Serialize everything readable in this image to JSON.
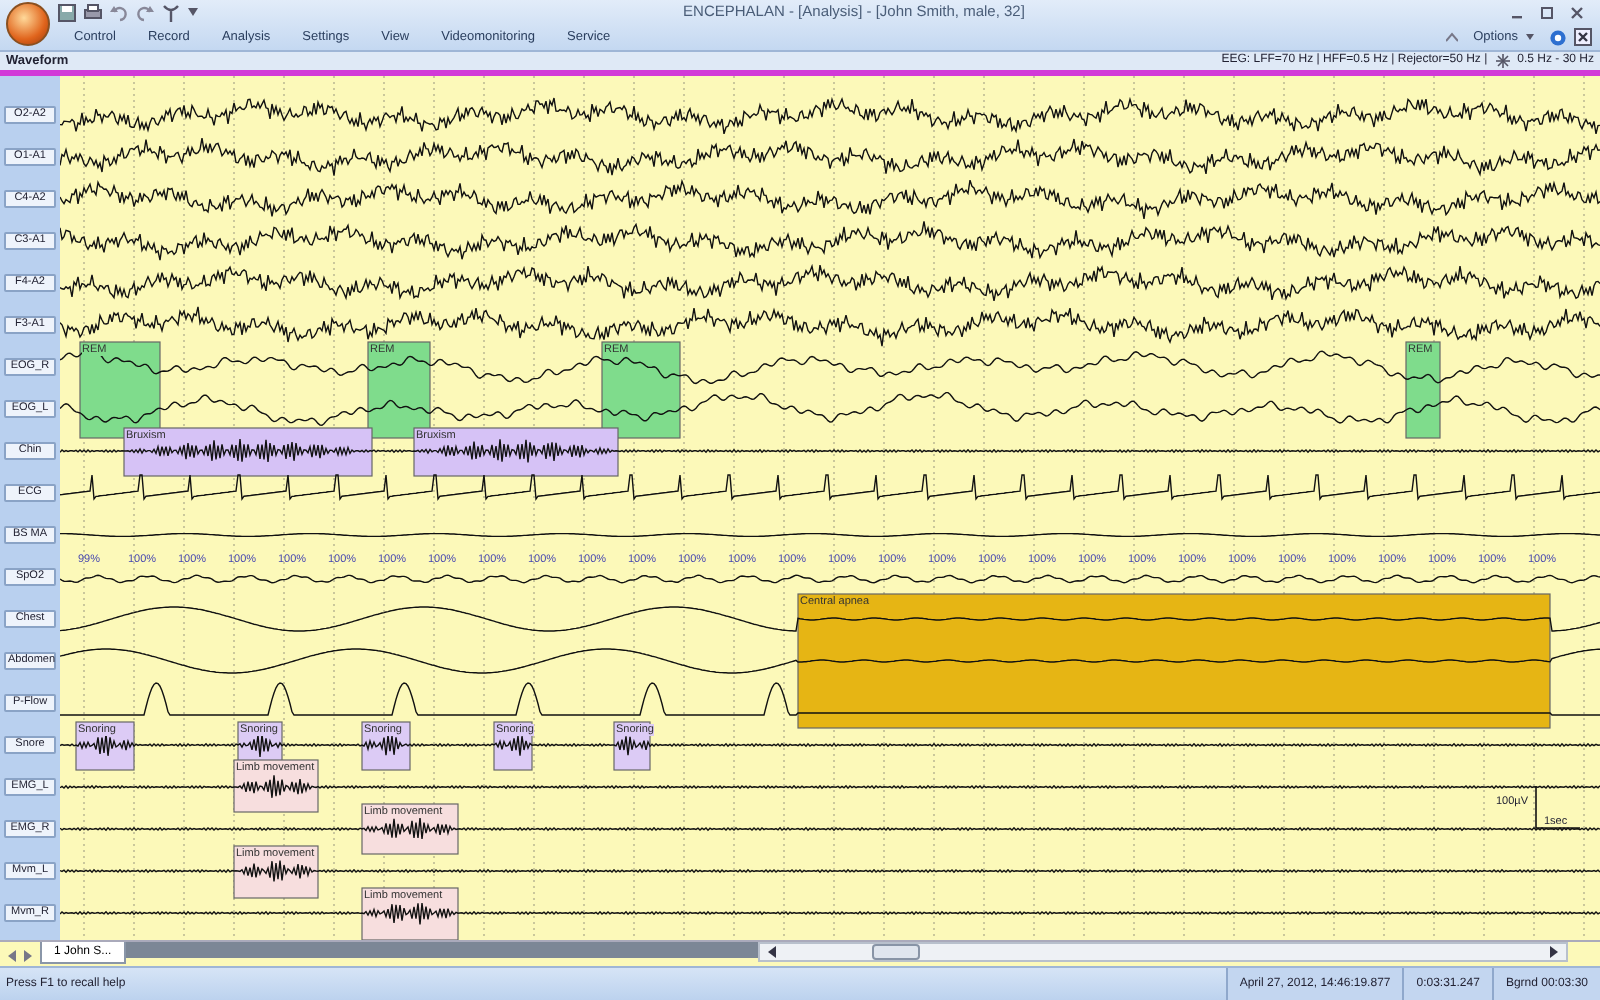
{
  "window": {
    "title": "ENCEPHALAN - [Analysis] - [John Smith, male, 32]"
  },
  "menu": [
    "Control",
    "Record",
    "Analysis",
    "Settings",
    "View",
    "Videomonitoring",
    "Service"
  ],
  "options_menu": {
    "label": "Options"
  },
  "panel": {
    "title": "Waveform",
    "filter_info": "EEG: LFF=70 Hz | HFF=0.5 Hz | Rejector=50 Hz |",
    "band": "0.5 Hz - 30 Hz"
  },
  "channels": [
    {
      "label": "O2-A2",
      "kind": "eeg"
    },
    {
      "label": "O1-A1",
      "kind": "eeg"
    },
    {
      "label": "C4-A2",
      "kind": "eeg"
    },
    {
      "label": "C3-A1",
      "kind": "eeg"
    },
    {
      "label": "F4-A2",
      "kind": "eeg"
    },
    {
      "label": "F3-A1",
      "kind": "eeg"
    },
    {
      "label": "EOG_R",
      "kind": "eog"
    },
    {
      "label": "EOG_L",
      "kind": "eog"
    },
    {
      "label": "Chin",
      "kind": "emg"
    },
    {
      "label": "ECG",
      "kind": "ecg"
    },
    {
      "label": "BS MA",
      "kind": "flat"
    },
    {
      "label": "SpO2",
      "kind": "spo2"
    },
    {
      "label": "Chest",
      "kind": "effort"
    },
    {
      "label": "Abdomen",
      "kind": "effort"
    },
    {
      "label": "P-Flow",
      "kind": "flow"
    },
    {
      "label": "Snore",
      "kind": "emg"
    },
    {
      "label": "EMG_L",
      "kind": "emg"
    },
    {
      "label": "EMG_R",
      "kind": "emg"
    },
    {
      "label": "Mvm_L",
      "kind": "emg"
    },
    {
      "label": "Mvm_R",
      "kind": "emg"
    }
  ],
  "spo2_readings": [
    "99%",
    "100%",
    "100%",
    "100%",
    "100%",
    "100%",
    "100%",
    "100%",
    "100%",
    "100%",
    "100%",
    "100%",
    "100%",
    "100%",
    "100%",
    "100%",
    "100%",
    "100%",
    "100%",
    "100%",
    "100%",
    "100%",
    "100%",
    "100%",
    "100%",
    "100%",
    "100%",
    "100%",
    "100%",
    "100%"
  ],
  "annotations": [
    {
      "label": "REM",
      "color": "#7fdc8c"
    },
    {
      "label": "REM",
      "color": "#7fdc8c"
    },
    {
      "label": "REM",
      "color": "#7fdc8c"
    },
    {
      "label": "REM",
      "color": "#7fdc8c"
    },
    {
      "label": "Bruxism",
      "color": "#d6c2f6"
    },
    {
      "label": "Bruxism",
      "color": "#d6c2f6"
    },
    {
      "label": "Central apnea",
      "color": "#e6b514"
    },
    {
      "label": "Snoring",
      "color": "#dccbf5"
    },
    {
      "label": "Snoring",
      "color": "#dccbf5"
    },
    {
      "label": "Snoring",
      "color": "#dccbf5"
    },
    {
      "label": "Snoring",
      "color": "#dccbf5"
    },
    {
      "label": "Snoring",
      "color": "#dccbf5"
    },
    {
      "label": "Limb movement",
      "color": "#f7dede"
    },
    {
      "label": "Limb movement",
      "color": "#f7dede"
    },
    {
      "label": "Limb movement",
      "color": "#f7dede"
    },
    {
      "label": "Limb movement",
      "color": "#f7dede"
    }
  ],
  "scale": {
    "amplitude": "100µV",
    "time": "1sec"
  },
  "tabs": [
    {
      "label": "1 John S...",
      "selected": true
    }
  ],
  "status_bar": {
    "hint": "Press F1 to recall help",
    "datetime": "April 27, 2012, 14:46:19.877",
    "position": "0:03:31.247",
    "background": "Bgrnd 00:03:30"
  }
}
